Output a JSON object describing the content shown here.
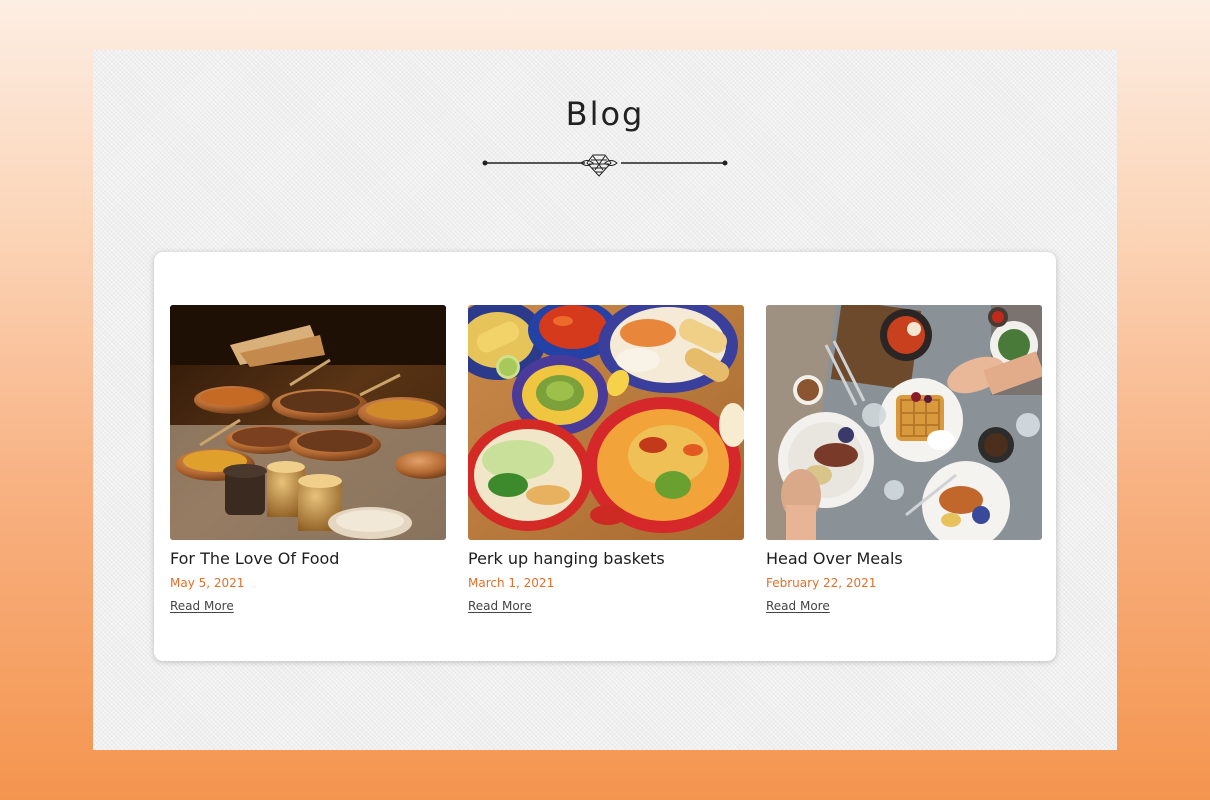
{
  "section": {
    "title": "Blog"
  },
  "posts": [
    {
      "title": "For The Love Of Food",
      "date": "May 5, 2021",
      "link_label": "Read More",
      "image": "indian-curry-buffet"
    },
    {
      "title": "Perk up hanging baskets",
      "date": "March 1, 2021",
      "link_label": "Read More",
      "image": "mexican-food-platter"
    },
    {
      "title": "Head Over Meals",
      "date": "February 22, 2021",
      "link_label": "Read More",
      "image": "brunch-table-overhead"
    }
  ],
  "colors": {
    "accent": "#e0702a",
    "title_text": "#1d1d1d",
    "card_bg": "#ffffff"
  }
}
